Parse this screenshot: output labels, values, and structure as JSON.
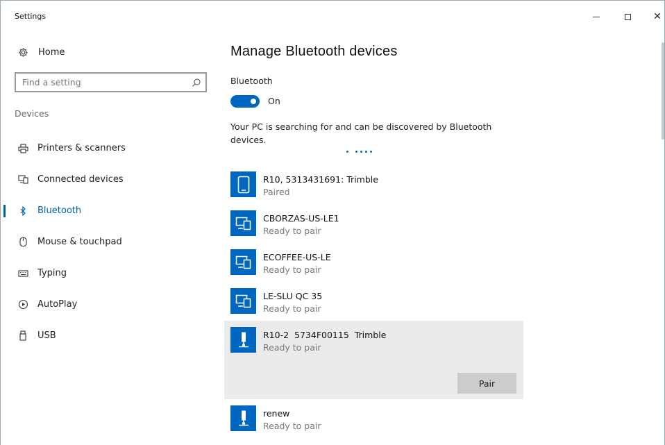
{
  "window": {
    "title": "Settings",
    "minimize_glyph": "–",
    "maximize_glyph": "□",
    "close_glyph": "✕"
  },
  "sidebar": {
    "home_label": "Home",
    "home_icon": "gear-icon",
    "search_placeholder": "Find a setting",
    "search_icon": "search-icon",
    "section_label": "Devices",
    "items": [
      {
        "label": "Printers & scanners",
        "icon": "printer-icon",
        "active": false
      },
      {
        "label": "Connected devices",
        "icon": "connected-devices-icon",
        "active": false
      },
      {
        "label": "Bluetooth",
        "icon": "bluetooth-icon",
        "active": true
      },
      {
        "label": "Mouse & touchpad",
        "icon": "mouse-icon",
        "active": false
      },
      {
        "label": "Typing",
        "icon": "keyboard-icon",
        "active": false
      },
      {
        "label": "AutoPlay",
        "icon": "autoplay-icon",
        "active": false
      },
      {
        "label": "USB",
        "icon": "usb-icon",
        "active": false
      }
    ]
  },
  "main": {
    "title": "Manage Bluetooth devices",
    "bluetooth_label": "Bluetooth",
    "toggle_state": "On",
    "toggle_on": true,
    "status_text": "Your PC is searching for and can be discovered by Bluetooth devices.",
    "pair_button_label": "Pair",
    "devices": [
      {
        "name": "R10, 5313431691: Trimble",
        "status": "Paired",
        "icon": "phone-icon"
      },
      {
        "name": "CBORZAS-US-LE1",
        "status": "Ready to pair",
        "icon": "computer-icon"
      },
      {
        "name": "ECOFFEE-US-LE",
        "status": "Ready to pair",
        "icon": "computer-icon"
      },
      {
        "name": "LE-SLU QC 35",
        "status": "Ready to pair",
        "icon": "computer-icon"
      },
      {
        "name": "R10-2  5734F00115  Trimble",
        "status": "Ready to pair",
        "icon": "device-icon",
        "selected": true
      },
      {
        "name": "renew",
        "status": "Ready to pair",
        "icon": "device-icon"
      }
    ]
  },
  "colors": {
    "accent": "#0067c0",
    "selected_row": "#ebebeb",
    "button_bg": "#cccccc"
  }
}
